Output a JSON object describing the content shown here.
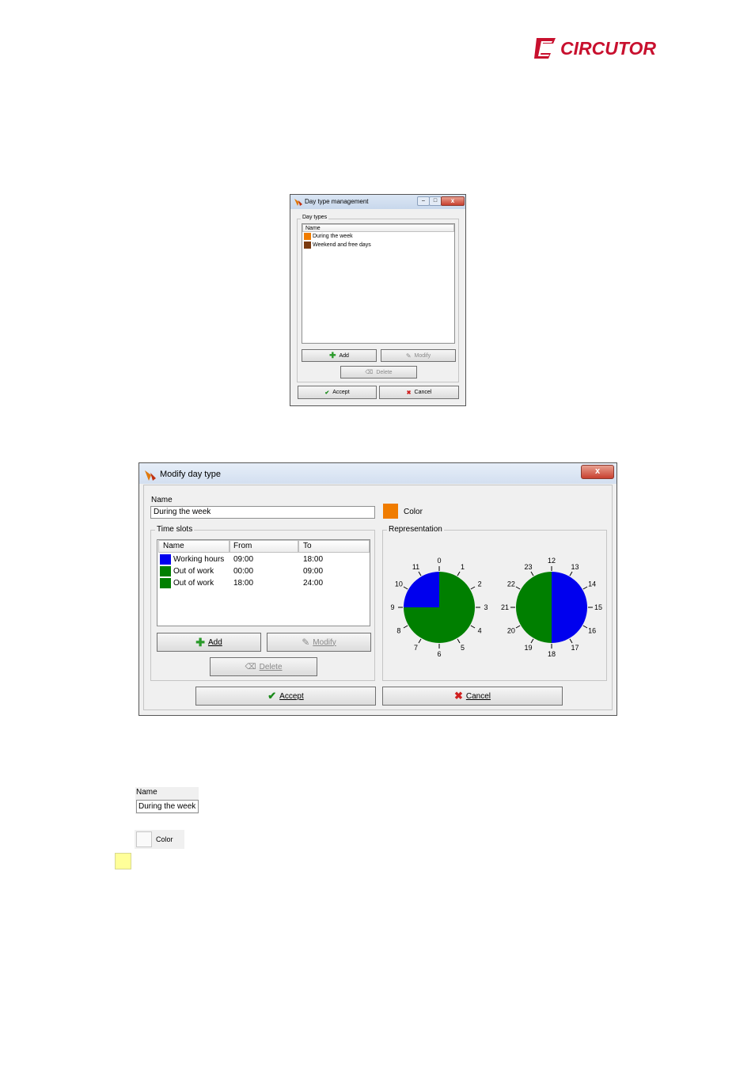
{
  "brand": {
    "logo_text": "CIRCUTOR",
    "logo_color": "#c8102e"
  },
  "day_type_window": {
    "title": "Day type management",
    "group_label": "Day types",
    "list_header": "Name",
    "items": [
      {
        "label": "During the week",
        "color": "#f07c00"
      },
      {
        "label": "Weekend and free days",
        "color": "#7a3a10"
      }
    ],
    "add_label": "Add",
    "modify_label": "Modify",
    "delete_label": "Delete",
    "accept_label": "Accept",
    "cancel_label": "Cancel"
  },
  "modify_window": {
    "title": "Modify day type",
    "name_label": "Name",
    "name_value": "During the week",
    "color_label": "Color",
    "color_value": "#f07c00",
    "time_slots_label": "Time slots",
    "columns": [
      "Name",
      "From",
      "To"
    ],
    "slots": [
      {
        "name": "Working hours",
        "from": "09:00",
        "to": "18:00",
        "color": "#0000ee"
      },
      {
        "name": "Out of work",
        "from": "00:00",
        "to": "09:00",
        "color": "#007f00"
      },
      {
        "name": "Out of work",
        "from": "18:00",
        "to": "24:00",
        "color": "#007f00"
      }
    ],
    "add_label": "Add",
    "modify_label": "Modify",
    "delete_label": "Delete",
    "representation_label": "Representation",
    "clock_am_labels": [
      "0",
      "1",
      "2",
      "3",
      "4",
      "5",
      "6",
      "7",
      "8",
      "9",
      "10",
      "11"
    ],
    "clock_pm_labels": [
      "12",
      "13",
      "14",
      "15",
      "16",
      "17",
      "18",
      "19",
      "20",
      "21",
      "22",
      "23"
    ],
    "accept_label": "Accept",
    "cancel_label": "Cancel"
  },
  "name_field_crop": {
    "label": "Name",
    "value": "During the week"
  },
  "color_button_crop": {
    "label": "Color"
  },
  "swatch_yellow": "#ffff99"
}
